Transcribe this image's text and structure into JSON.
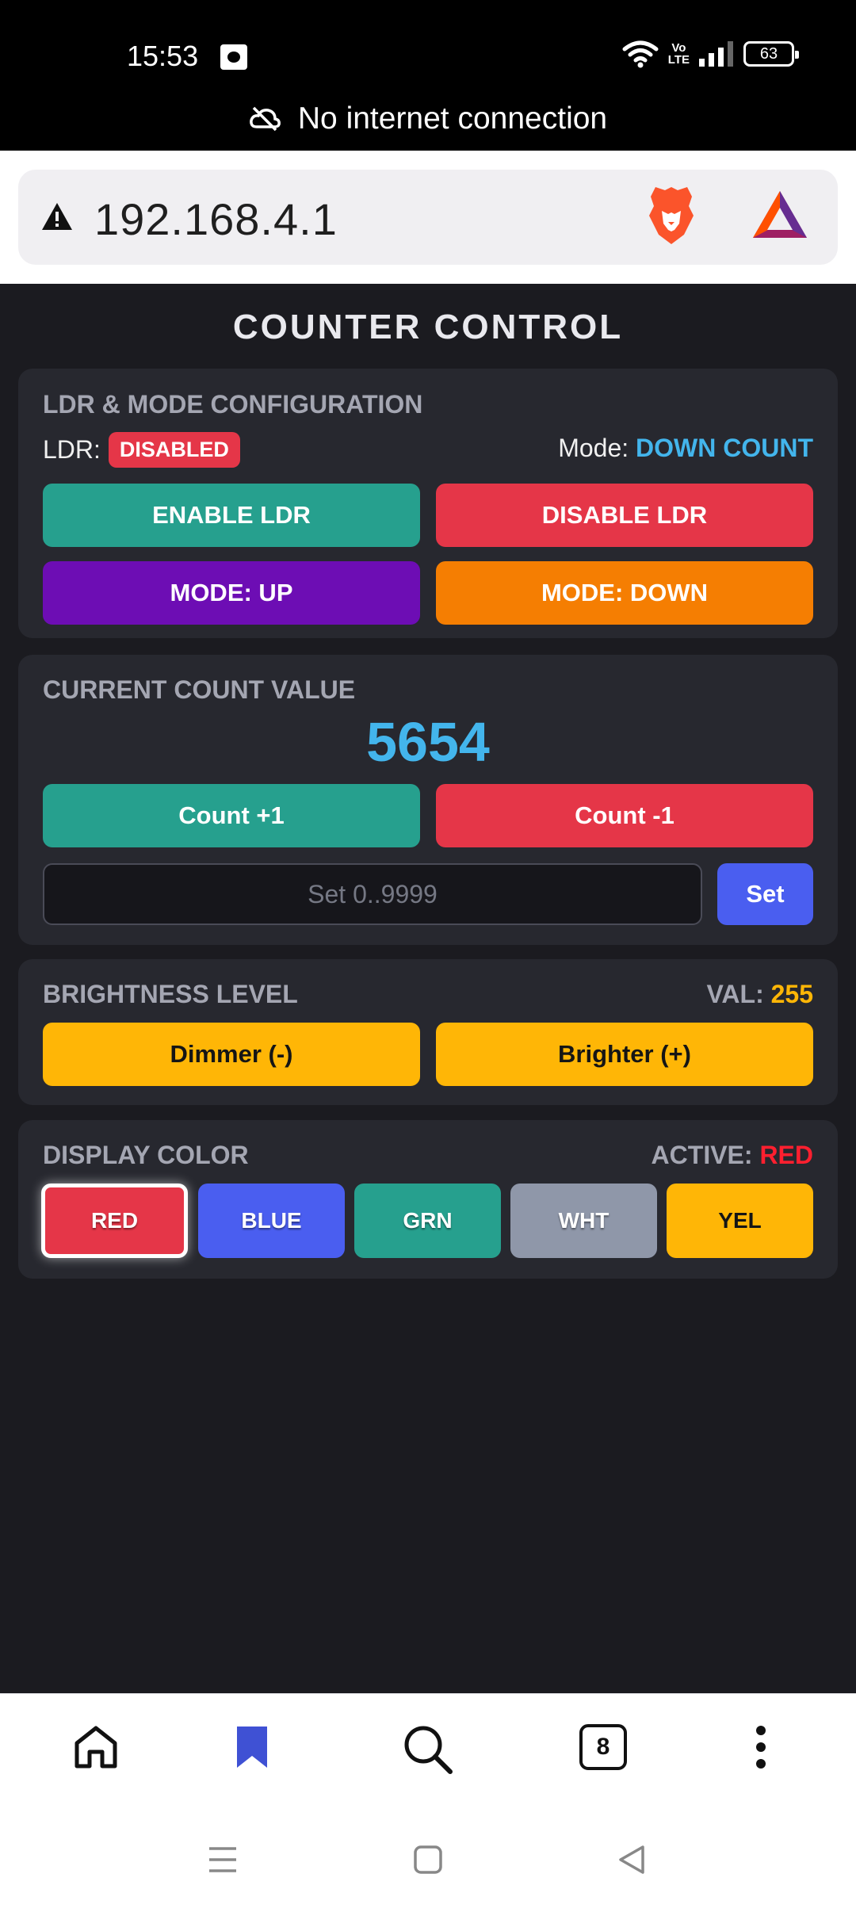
{
  "status_bar": {
    "time": "15:53",
    "network_type": "Vo\nLTE",
    "battery": "63",
    "connection_message": "No internet connection"
  },
  "browser": {
    "url": "192.168.4.1"
  },
  "app": {
    "title": "COUNTER CONTROL",
    "ldr_card": {
      "heading": "LDR & MODE CONFIGURATION",
      "ldr_label": "LDR:",
      "ldr_status": "DISABLED",
      "mode_label": "Mode:",
      "mode_value": "DOWN COUNT",
      "enable_ldr": "ENABLE LDR",
      "disable_ldr": "DISABLE LDR",
      "mode_up": "MODE: UP",
      "mode_down": "MODE: DOWN"
    },
    "count_card": {
      "heading": "CURRENT COUNT VALUE",
      "value": "5654",
      "count_plus": "Count +1",
      "count_minus": "Count -1",
      "set_placeholder": "Set 0..9999",
      "set_value": "",
      "set_button": "Set"
    },
    "brightness_card": {
      "heading": "BRIGHTNESS LEVEL",
      "val_label": "VAL:",
      "val": "255",
      "dimmer": "Dimmer (-)",
      "brighter": "Brighter (+)"
    },
    "color_card": {
      "heading": "DISPLAY COLOR",
      "active_label": "ACTIVE:",
      "active_value": "RED",
      "colors": [
        "RED",
        "BLUE",
        "GRN",
        "WHT",
        "YEL"
      ]
    }
  },
  "toolbar": {
    "tab_count": "8"
  }
}
